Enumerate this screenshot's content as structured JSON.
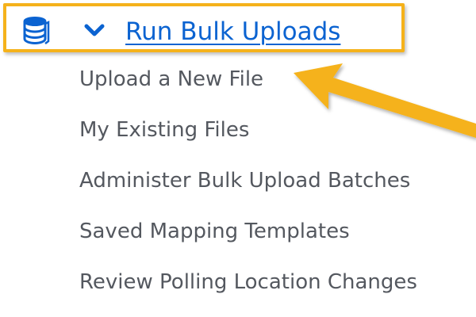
{
  "menu": {
    "header": {
      "label": "Run Bulk Uploads",
      "icon": "database-stack-icon",
      "toggle_icon": "chevron-down-icon",
      "link_color": "#0b63d1"
    },
    "items": [
      {
        "label": "Upload a New File"
      },
      {
        "label": "My Existing Files"
      },
      {
        "label": "Administer Bulk Upload Batches"
      },
      {
        "label": "Saved Mapping Templates"
      },
      {
        "label": "Review Polling Location Changes"
      }
    ]
  },
  "annotation": {
    "highlight_color": "#f5b21b",
    "arrow_color": "#f5b21b",
    "arrow_icon": "pointer-arrow-icon"
  }
}
